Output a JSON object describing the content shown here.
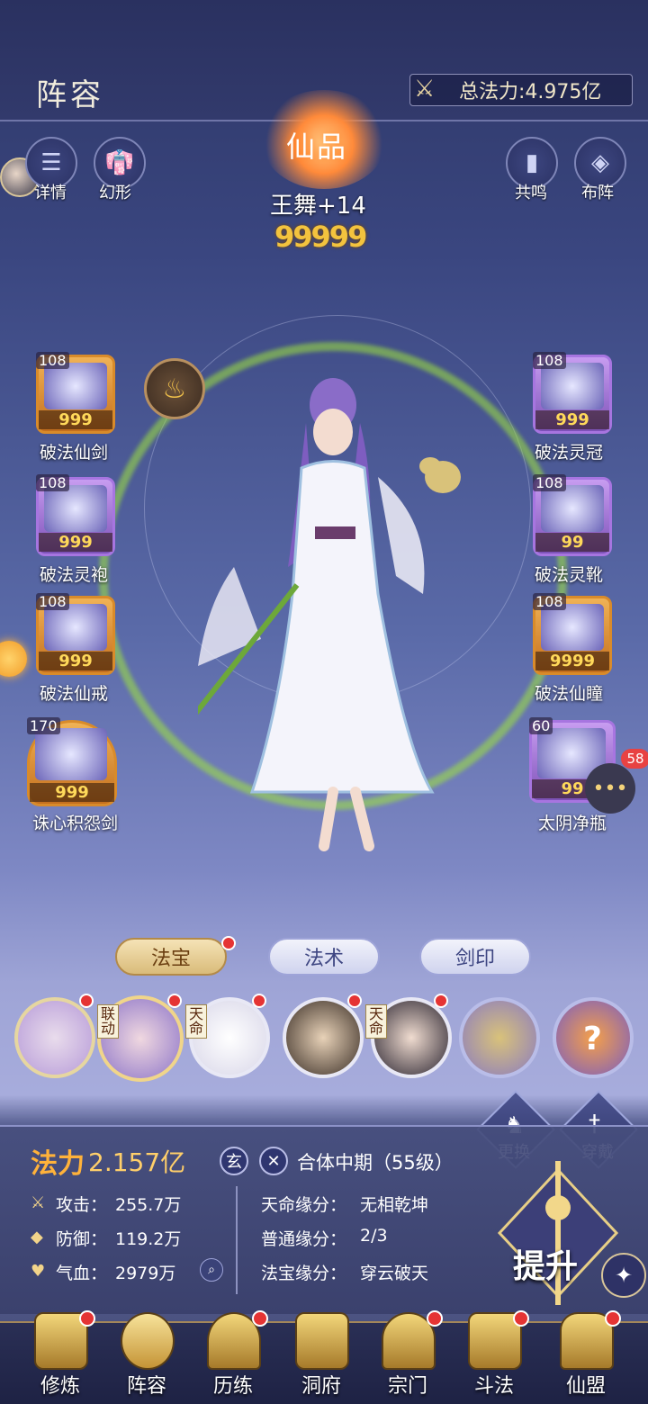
{
  "header": {
    "title": "阵容",
    "power_label": "总法力:",
    "power_value": "4.975亿"
  },
  "top_buttons": {
    "details": "详情",
    "illusion": "幻形",
    "resonance": "共鸣",
    "formation": "布阵"
  },
  "character": {
    "grade": "仙品",
    "name": "王舞+14",
    "stars": "99999"
  },
  "equipment_left": [
    {
      "level": "108",
      "stars": "999",
      "name": "破法仙剑",
      "rarity": "orange"
    },
    {
      "level": "108",
      "stars": "999",
      "name": "破法灵袍",
      "rarity": "purple"
    },
    {
      "level": "108",
      "stars": "999",
      "name": "破法仙戒",
      "rarity": "orange"
    },
    {
      "level": "170",
      "stars": "999",
      "name": "诛心积怨剑",
      "rarity": "orange"
    }
  ],
  "equipment_right": [
    {
      "level": "108",
      "stars": "999",
      "name": "破法灵冠",
      "rarity": "purple"
    },
    {
      "level": "108",
      "stars": "99",
      "name": "破法灵靴",
      "rarity": "purple"
    },
    {
      "level": "108",
      "stars": "9999",
      "name": "破法仙瞳",
      "rarity": "orange"
    },
    {
      "level": "60",
      "stars": "99",
      "name": "太阴净瓶",
      "rarity": "purple"
    }
  ],
  "chat_badge": "58",
  "tabs": [
    {
      "label": "法宝",
      "active": true
    },
    {
      "label": "法术",
      "active": false
    },
    {
      "label": "剑印",
      "active": false
    }
  ],
  "portraits": [
    {
      "tag": "",
      "color": "#b69ad8"
    },
    {
      "tag": "联动",
      "color": "#8c74c8"
    },
    {
      "tag": "天命",
      "color": "#e4e2ee"
    },
    {
      "tag": "",
      "color": "#5a4a3a"
    },
    {
      "tag": "天命",
      "color": "#3a3440"
    },
    {
      "tag": "",
      "color": "#8a7bc0"
    },
    {
      "tag": "",
      "color": "#e37a2e"
    }
  ],
  "actions": {
    "swap": "更换",
    "equip": "穿戴",
    "upgrade": "提升"
  },
  "stats": {
    "fali_label": "法力",
    "fali_value": "2.157亿",
    "xuan": "玄",
    "realm": "合体中期（55级）",
    "attack_label": "攻击：",
    "attack_value": "255.7万",
    "defense_label": "防御：",
    "defense_value": "119.2万",
    "hp_label": "气血：",
    "hp_value": "2979万",
    "fate_label": "天命缘分：",
    "fate_value": "无相乾坤",
    "normal_label": "普通缘分：",
    "normal_value": "2/3",
    "treasure_label": "法宝缘分：",
    "treasure_value": "穿云破天"
  },
  "bottom_nav": [
    {
      "label": "修炼",
      "dot": true
    },
    {
      "label": "阵容",
      "dot": false
    },
    {
      "label": "历练",
      "dot": true
    },
    {
      "label": "洞府",
      "dot": false
    },
    {
      "label": "宗门",
      "dot": true
    },
    {
      "label": "斗法",
      "dot": true
    },
    {
      "label": "仙盟",
      "dot": true
    }
  ]
}
